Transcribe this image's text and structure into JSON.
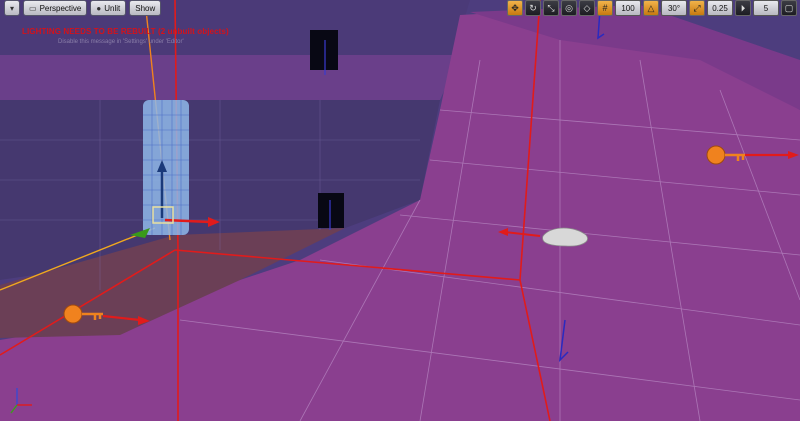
{
  "toolbar_left": {
    "perspective_label": "Perspective",
    "unlit_label": "Unlit",
    "show_label": "Show"
  },
  "toolbar_right": {
    "grid_snap_value": "100",
    "rotation_snap_value": "30°",
    "camera_speed_value": "5"
  },
  "warning": {
    "text": "LIGHTING NEEDS TO BE REBUILT (2 unbuilt objects)",
    "sub_text": "Disable this message in 'Settings' under 'Editor'"
  },
  "colors": {
    "sky": "#4f3f7f",
    "floor": "#8a3f8f",
    "accent_warning": "#d4121b",
    "gizmo_orange": "#f0821e",
    "gizmo_red": "#e11b1b"
  },
  "icons": [
    "menu-icon",
    "sphere-icon",
    "globe-icon",
    "surface-snap-icon",
    "translate-icon",
    "grid-icon",
    "rotate-icon",
    "scale-icon",
    "camera-speed-icon",
    "maximize-icon"
  ]
}
